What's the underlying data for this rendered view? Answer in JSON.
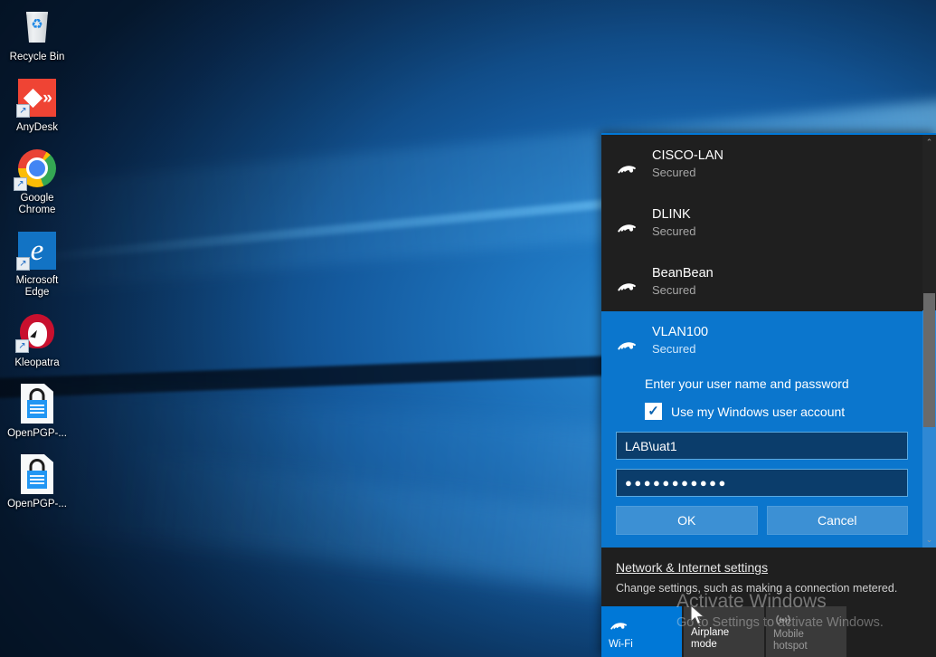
{
  "desktop": {
    "icons": [
      {
        "label": "Recycle Bin",
        "icon": "recycle-bin-icon"
      },
      {
        "label": "AnyDesk",
        "icon": "anydesk-icon"
      },
      {
        "label": "Google\nChrome",
        "icon": "google-chrome-icon"
      },
      {
        "label": "Microsoft\nEdge",
        "icon": "microsoft-edge-icon"
      },
      {
        "label": "Kleopatra",
        "icon": "kleopatra-icon"
      },
      {
        "label": "OpenPGP-...",
        "icon": "openpgp-file-icon"
      },
      {
        "label": "OpenPGP-...",
        "icon": "openpgp-file-icon"
      }
    ]
  },
  "network_flyout": {
    "networks": [
      {
        "name": "CISCO-LAN",
        "status": "Secured"
      },
      {
        "name": "DLINK",
        "status": "Secured"
      },
      {
        "name": "BeanBean",
        "status": "Secured"
      }
    ],
    "selected_network": {
      "name": "VLAN100",
      "status": "Secured",
      "prompt": "Enter your user name and password",
      "checkbox_label": "Use my Windows user account",
      "checkbox_checked": true,
      "checkmark": "✓",
      "username_value": "LAB\\uat1",
      "password_value": "●●●●●●●●●●●",
      "ok_label": "OK",
      "cancel_label": "Cancel"
    },
    "scrollbar": {
      "up_arrow": "⌃",
      "down_arrow": "⌄"
    },
    "footer": {
      "settings_link": "Network & Internet settings",
      "settings_description": "Change settings, such as making a connection metered.",
      "tiles": [
        {
          "label": "Wi-Fi",
          "state": "on",
          "icon": "wifi-icon"
        },
        {
          "label": "Airplane mode",
          "state": "off",
          "icon": "airplane-icon"
        },
        {
          "label": "Mobile\nhotspot",
          "state": "off",
          "icon": "hotspot-icon"
        }
      ]
    }
  },
  "watermark": {
    "title": "Activate Windows",
    "subtitle": "Go to Settings to activate Windows."
  },
  "colors": {
    "accent": "#0078d7",
    "selected_panel": "#0b76cd",
    "flyout_background": "#1f1f1f",
    "tile_off": "#3a3a3a",
    "button": "#3c90d4"
  }
}
